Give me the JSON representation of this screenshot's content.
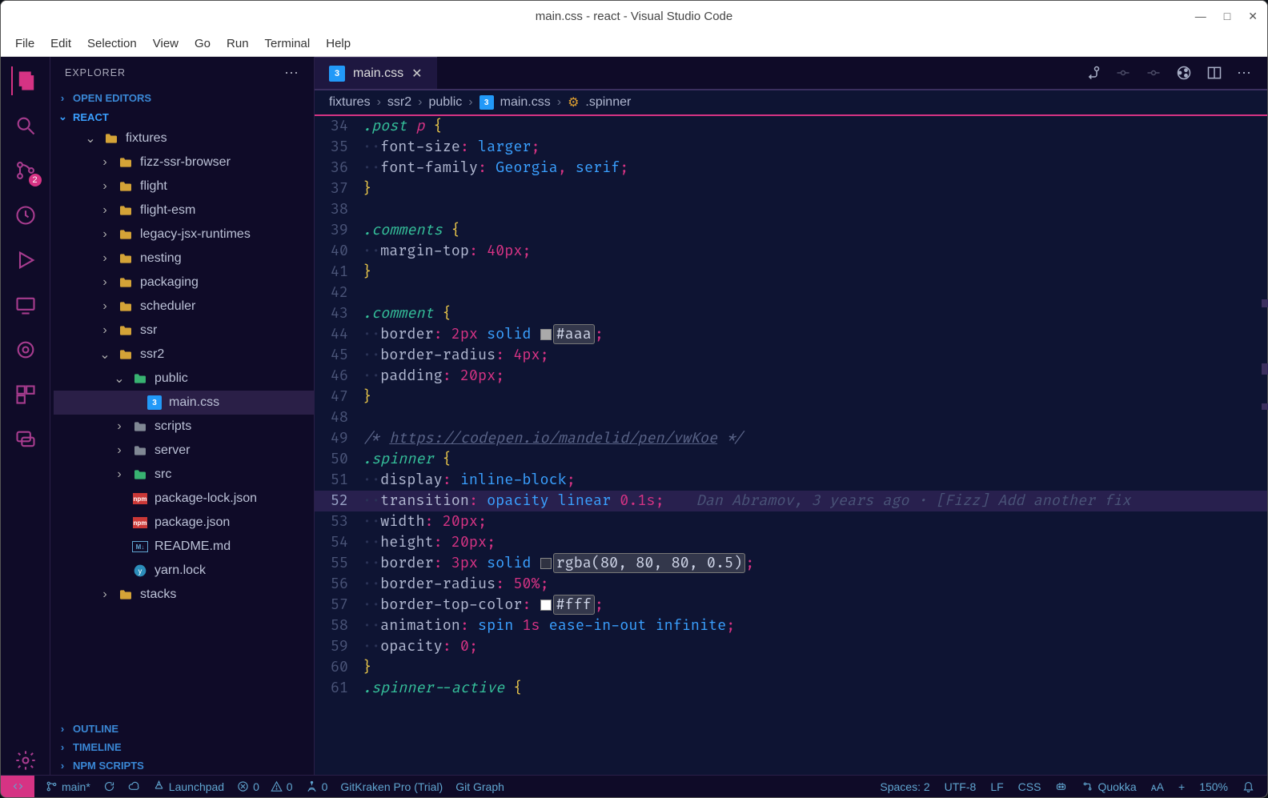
{
  "window": {
    "title": "main.css - react - Visual Studio Code"
  },
  "menu": [
    "File",
    "Edit",
    "Selection",
    "View",
    "Go",
    "Run",
    "Terminal",
    "Help"
  ],
  "activity": {
    "badge_scm": "2"
  },
  "explorer": {
    "title": "EXPLORER",
    "open_editors": "OPEN EDITORS",
    "root": "REACT",
    "outline": "OUTLINE",
    "timeline": "TIMELINE",
    "npm": "NPM SCRIPTS",
    "tree": [
      {
        "d": 1,
        "t": "folder",
        "open": true,
        "n": "fixtures"
      },
      {
        "d": 2,
        "t": "folder",
        "open": false,
        "n": "fizz-ssr-browser"
      },
      {
        "d": 2,
        "t": "folder",
        "open": false,
        "n": "flight"
      },
      {
        "d": 2,
        "t": "folder",
        "open": false,
        "n": "flight-esm"
      },
      {
        "d": 2,
        "t": "folder",
        "open": false,
        "n": "legacy-jsx-runtimes"
      },
      {
        "d": 2,
        "t": "folder",
        "open": false,
        "n": "nesting"
      },
      {
        "d": 2,
        "t": "folder",
        "open": false,
        "n": "packaging"
      },
      {
        "d": 2,
        "t": "folder",
        "open": false,
        "n": "scheduler"
      },
      {
        "d": 2,
        "t": "folder",
        "open": false,
        "n": "ssr"
      },
      {
        "d": 2,
        "t": "folder",
        "open": true,
        "n": "ssr2"
      },
      {
        "d": 3,
        "t": "folder",
        "open": true,
        "n": "public",
        "icon": "green"
      },
      {
        "d": 4,
        "t": "file",
        "n": "main.css",
        "icon": "css",
        "sel": true
      },
      {
        "d": 3,
        "t": "folder",
        "open": false,
        "n": "scripts",
        "icon": "gray"
      },
      {
        "d": 3,
        "t": "folder",
        "open": false,
        "n": "server",
        "icon": "gray"
      },
      {
        "d": 3,
        "t": "folder",
        "open": false,
        "n": "src",
        "icon": "green"
      },
      {
        "d": 3,
        "t": "file",
        "n": "package-lock.json",
        "icon": "npm"
      },
      {
        "d": 3,
        "t": "file",
        "n": "package.json",
        "icon": "npm"
      },
      {
        "d": 3,
        "t": "file",
        "n": "README.md",
        "icon": "md"
      },
      {
        "d": 3,
        "t": "file",
        "n": "yarn.lock",
        "icon": "yarn"
      },
      {
        "d": 2,
        "t": "folder",
        "open": false,
        "n": "stacks"
      }
    ]
  },
  "tab": {
    "name": "main.css"
  },
  "breadcrumb": [
    "fixtures",
    "ssr2",
    "public",
    "main.css",
    ".spinner"
  ],
  "code": {
    "start": 34,
    "current": 52,
    "blame": "Dan Abramov, 3 years ago · [Fizz] Add another fix",
    "lines": [
      [
        [
          "sel",
          ".post "
        ],
        [
          "tag",
          "p "
        ],
        [
          "brace",
          "{"
        ]
      ],
      [
        [
          "dot",
          "··"
        ],
        [
          "prop",
          "font-size"
        ],
        [
          "punc",
          ": "
        ],
        [
          "val",
          "larger"
        ],
        [
          "punc",
          ";"
        ]
      ],
      [
        [
          "dot",
          "··"
        ],
        [
          "prop",
          "font-family"
        ],
        [
          "punc",
          ": "
        ],
        [
          "val",
          "Georgia"
        ],
        [
          "punc",
          ", "
        ],
        [
          "val",
          "serif"
        ],
        [
          "punc",
          ";"
        ]
      ],
      [
        [
          "brace",
          "}"
        ]
      ],
      [],
      [
        [
          "sel",
          ".comments "
        ],
        [
          "brace",
          "{"
        ]
      ],
      [
        [
          "dot",
          "··"
        ],
        [
          "prop",
          "margin-top"
        ],
        [
          "punc",
          ": "
        ],
        [
          "num",
          "40px"
        ],
        [
          "punc",
          ";"
        ]
      ],
      [
        [
          "brace",
          "}"
        ]
      ],
      [],
      [
        [
          "sel",
          ".comment "
        ],
        [
          "brace",
          "{"
        ]
      ],
      [
        [
          "dot",
          "··"
        ],
        [
          "prop",
          "border"
        ],
        [
          "punc",
          ": "
        ],
        [
          "num",
          "2px "
        ],
        [
          "val",
          "solid "
        ],
        [
          "chip",
          "#aaa"
        ],
        [
          "colorval",
          "#aaa"
        ],
        [
          "punc",
          ";"
        ]
      ],
      [
        [
          "dot",
          "··"
        ],
        [
          "prop",
          "border-radius"
        ],
        [
          "punc",
          ": "
        ],
        [
          "num",
          "4px"
        ],
        [
          "punc",
          ";"
        ]
      ],
      [
        [
          "dot",
          "··"
        ],
        [
          "prop",
          "padding"
        ],
        [
          "punc",
          ": "
        ],
        [
          "num",
          "20px"
        ],
        [
          "punc",
          ";"
        ]
      ],
      [
        [
          "brace",
          "}"
        ]
      ],
      [],
      [
        [
          "comment",
          "/* "
        ],
        [
          "link",
          "https://codepen.io/mandelid/pen/vwKoe"
        ],
        [
          "comment",
          " */"
        ]
      ],
      [
        [
          "sel",
          ".spinner "
        ],
        [
          "brace",
          "{"
        ]
      ],
      [
        [
          "dot",
          "··"
        ],
        [
          "prop",
          "display"
        ],
        [
          "punc",
          ": "
        ],
        [
          "val",
          "inline-block"
        ],
        [
          "punc",
          ";"
        ]
      ],
      [
        [
          "dot",
          "··"
        ],
        [
          "prop",
          "transition"
        ],
        [
          "punc",
          ": "
        ],
        [
          "val",
          "opacity "
        ],
        [
          "val",
          "linear "
        ],
        [
          "num",
          "0.1s"
        ],
        [
          "punc",
          ";"
        ]
      ],
      [
        [
          "dot",
          "··"
        ],
        [
          "prop",
          "width"
        ],
        [
          "punc",
          ": "
        ],
        [
          "num",
          "20px"
        ],
        [
          "punc",
          ";"
        ]
      ],
      [
        [
          "dot",
          "··"
        ],
        [
          "prop",
          "height"
        ],
        [
          "punc",
          ": "
        ],
        [
          "num",
          "20px"
        ],
        [
          "punc",
          ";"
        ]
      ],
      [
        [
          "dot",
          "··"
        ],
        [
          "prop",
          "border"
        ],
        [
          "punc",
          ": "
        ],
        [
          "num",
          "3px "
        ],
        [
          "val",
          "solid "
        ],
        [
          "chip",
          "rgba(80,80,80,0.5)"
        ],
        [
          "colorval",
          "rgba(80, 80, 80, 0.5)"
        ],
        [
          "punc",
          ";"
        ]
      ],
      [
        [
          "dot",
          "··"
        ],
        [
          "prop",
          "border-radius"
        ],
        [
          "punc",
          ": "
        ],
        [
          "num",
          "50%"
        ],
        [
          "punc",
          ";"
        ]
      ],
      [
        [
          "dot",
          "··"
        ],
        [
          "prop",
          "border-top-color"
        ],
        [
          "punc",
          ": "
        ],
        [
          "chip",
          "#fff"
        ],
        [
          "colorval",
          "#fff"
        ],
        [
          "punc",
          ";"
        ]
      ],
      [
        [
          "dot",
          "··"
        ],
        [
          "prop",
          "animation"
        ],
        [
          "punc",
          ": "
        ],
        [
          "val",
          "spin "
        ],
        [
          "num",
          "1s "
        ],
        [
          "val",
          "ease-in-out "
        ],
        [
          "val",
          "infinite"
        ],
        [
          "punc",
          ";"
        ]
      ],
      [
        [
          "dot",
          "··"
        ],
        [
          "prop",
          "opacity"
        ],
        [
          "punc",
          ": "
        ],
        [
          "num",
          "0"
        ],
        [
          "punc",
          ";"
        ]
      ],
      [
        [
          "brace",
          "}"
        ]
      ],
      [
        [
          "sel",
          ".spinner--active "
        ],
        [
          "brace",
          "{"
        ]
      ]
    ]
  },
  "status": {
    "branch": "main*",
    "sync": "",
    "launchpad": "Launchpad",
    "errors": "0",
    "warnings": "0",
    "ports": "0",
    "gitkraken": "GitKraken Pro (Trial)",
    "gitgraph": "Git Graph",
    "spaces": "Spaces: 2",
    "encoding": "UTF-8",
    "eol": "LF",
    "lang": "CSS",
    "quokka": "Quokka",
    "porcelain": "ᴀA",
    "plus": "+",
    "zoom": "150%"
  }
}
